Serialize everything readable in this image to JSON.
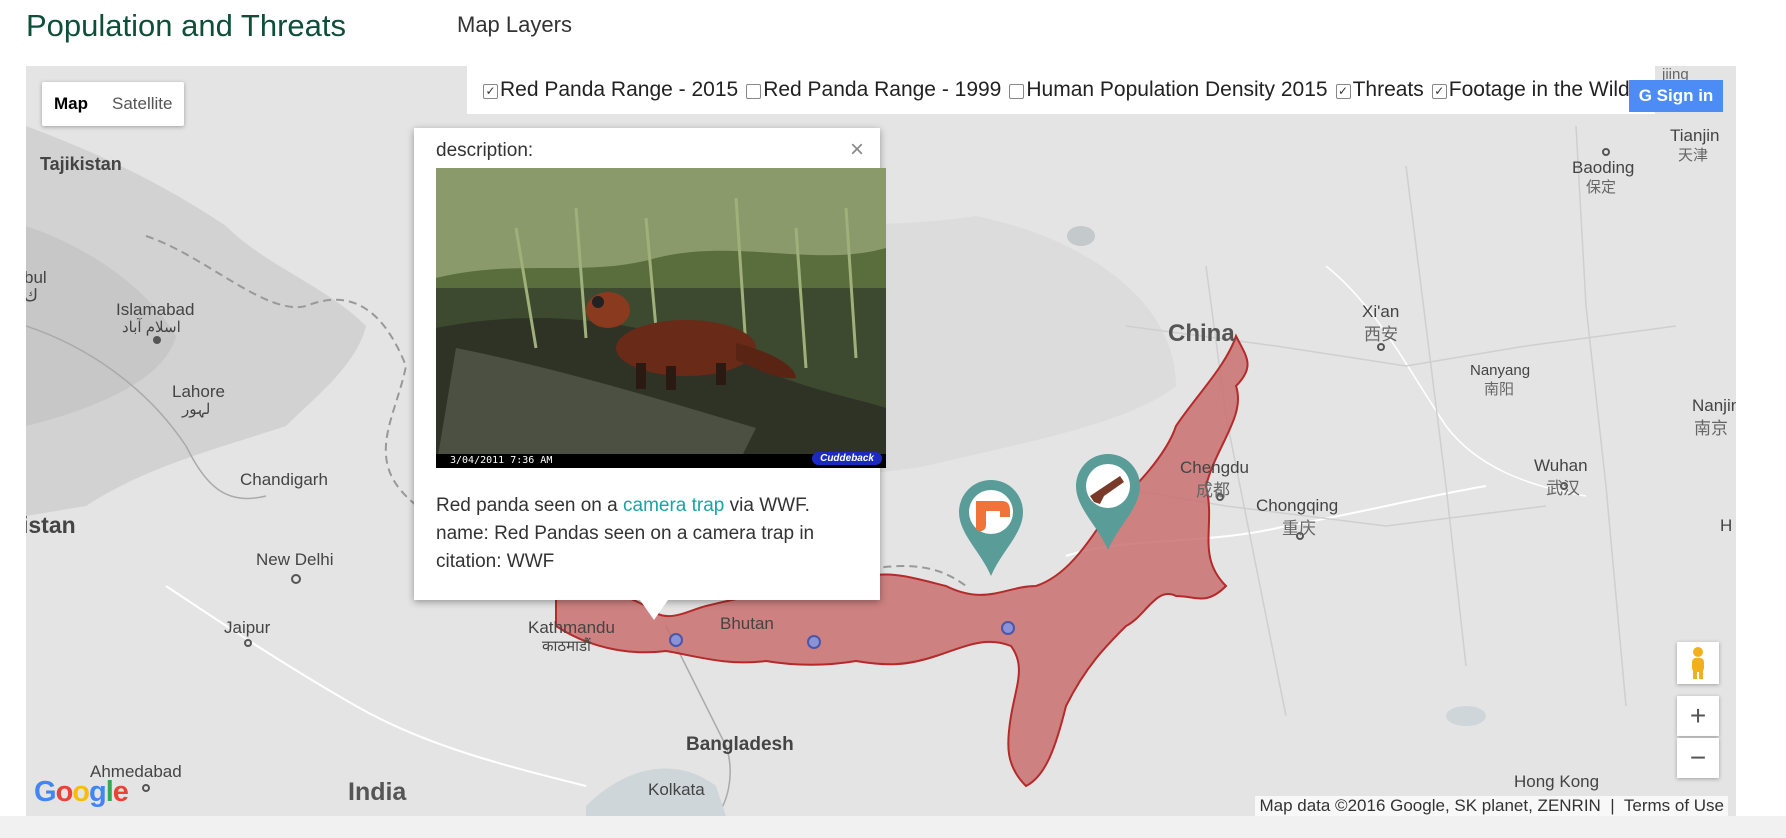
{
  "header": {
    "title": "Population and Threats",
    "layers_title": "Map Layers"
  },
  "layers": [
    {
      "label": "Red Panda Range - 2015",
      "checked": true
    },
    {
      "label": "Red Panda Range - 1999",
      "checked": false
    },
    {
      "label": "Human Population Density 2015",
      "checked": false
    },
    {
      "label": "Threats",
      "checked": true
    },
    {
      "label": "Footage in the Wild",
      "checked": true
    }
  ],
  "map_type": {
    "map_label": "Map",
    "satellite_label": "Satellite",
    "selected": "Map"
  },
  "signin_label": "Sign in",
  "popup": {
    "close_glyph": "×",
    "description_label": "description:",
    "photo_stamp": "3/04/2011  7:36 AM",
    "photo_logo": "Cuddeback",
    "line1_before": "Red panda seen on a ",
    "line1_link": "camera trap",
    "line1_after": " via WWF.",
    "line2": "name: Red Pandas seen on a camera trap in",
    "line3": "citation: WWF"
  },
  "map_labels": {
    "tajikistan": "Tajikistan",
    "kabul": "bul",
    "kabul2": "ك",
    "islamabad": "Islamabad",
    "islamabad_ur": "اسلام آباد",
    "lahore": "Lahore",
    "lahore_ur": "لہور",
    "chandigarh": "Chandigarh",
    "istan": "istan",
    "new_delhi": "New Delhi",
    "jaipur": "Jaipur",
    "ahmedabad": "Ahmedabad",
    "india": "India",
    "kathmandu": "Kathmandu",
    "kathmandu_ne": "काठमाडौं",
    "bhutan": "Bhutan",
    "bangladesh": "Bangladesh",
    "kolkata": "Kolkata",
    "china": "China",
    "xian": "Xi'an",
    "xian_cn": "西安",
    "chengdu": "Chengdu",
    "chengdu_cn": "成都",
    "chongqing": "Chongqing",
    "chongqing_cn": "重庆",
    "wuhan": "Wuhan",
    "wuhan_cn": "武汉",
    "nanyang": "Nanyang",
    "nanyang_cn": "南阳",
    "nanjing": "Nanjin",
    "nanjing_cn": "南京",
    "baoding": "Baoding",
    "baoding_cn": "保定",
    "tianjin": "Tianjin",
    "tianjin_cn": "天津",
    "hong_kong": "Hong Kong",
    "h_edge": "H",
    "jiing": "jiing"
  },
  "zoom": {
    "in": "+",
    "out": "−"
  },
  "google_logo": "Google",
  "attribution": "Map data ©2016 Google, SK planet, ZENRIN",
  "terms": "Terms of Use",
  "colors": {
    "range_fill": "#c9706e",
    "range_stroke": "#b52a2a",
    "marker_teal": "#5a9c98",
    "marker_orange": "#f0743a",
    "link": "#1aa3a3",
    "signin": "#4d8cf5",
    "title": "#0f4f3a"
  },
  "icons": [
    "pin-icon",
    "gun-icon",
    "trap-icon",
    "pegman-icon",
    "close-icon"
  ]
}
